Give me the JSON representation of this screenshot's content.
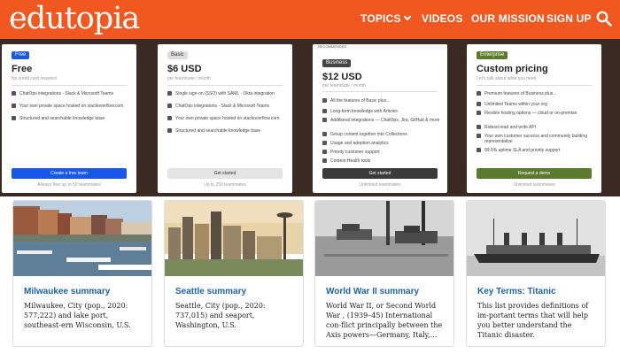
{
  "header": {
    "logo": "edutopia",
    "nav": [
      {
        "label": "TOPICS"
      },
      {
        "label": "VIDEOS"
      },
      {
        "label": "OUR MISSION"
      },
      {
        "label": "SIGN UP"
      }
    ],
    "accent_color": "#f0581f"
  },
  "pricing": [
    {
      "badge": "Free",
      "title": "Free",
      "subtitle": "No credit card required",
      "features": [
        "ChatOps integrations - Slack & Microsoft Teams",
        "Your own private space hosted on stackoverflow.com",
        "Structured and searchable knowledge base"
      ],
      "button": "Create a free team",
      "footer": "Always free up to 50 teammates",
      "button_color": "#1a56e8"
    },
    {
      "badge": "Basic",
      "title": "$6 USD",
      "subtitle": "per teammate / month",
      "features": [
        "Single sign-on (SSO) with SAML - Okta integration",
        "ChatOps integrations - Slack & Microsoft Teams",
        "Your own private space hosted on stackoverflow.com",
        "Structured and searchable knowledge base"
      ],
      "button": "Get started",
      "footer": "Up to 250 teammates",
      "button_color": "#e4e4e4"
    },
    {
      "top_strip": "RECOMMENDED",
      "badge": "Business",
      "title": "$12 USD",
      "subtitle": "per teammate / month",
      "features": [
        "All the features of Basic plus...",
        "Long-form knowledge with Articles",
        "Additional integrations — ChatOps, Jira, GitHub & more",
        "Group content together into Collections",
        "Usage and adoption analytics",
        "Priority customer support",
        "Content Health tools"
      ],
      "button": "Get started",
      "footer": "Unlimited teammates",
      "button_color": "#3a3a3a"
    },
    {
      "badge": "Enterprise",
      "title": "Custom pricing",
      "subtitle": "Let's talk about what you need",
      "features": [
        "Premium features of Business plus...",
        "Unlimited Teams within your org",
        "Flexible hosting options — cloud or on-premise",
        "Robust read and write API",
        "Your own customer success and community building representative",
        "99.5% uptime SLA and priority support"
      ],
      "button": "Request a demo",
      "footer": "Unlimited teammates",
      "button_color": "#5a7a2e"
    }
  ],
  "articles": [
    {
      "title": "Milwaukee summary",
      "description": "Milwaukee, City (pop., 2020: 577,222) and lake port, southeast-ern Wisconsin, U.S."
    },
    {
      "title": "Seattle summary",
      "description": "Seattle, City (pop., 2020: 737,015) and seaport, Washington, U.S."
    },
    {
      "title": "World War II summary",
      "description": "World War II, or Second World War , (1939–45) International con-flict principally between the Axis powers—Germany, Italy,..."
    },
    {
      "title": "Key Terms: Titanic",
      "description": "This list provides definitions of im-portant terms that will help you better understand the Titanic disaster."
    }
  ]
}
